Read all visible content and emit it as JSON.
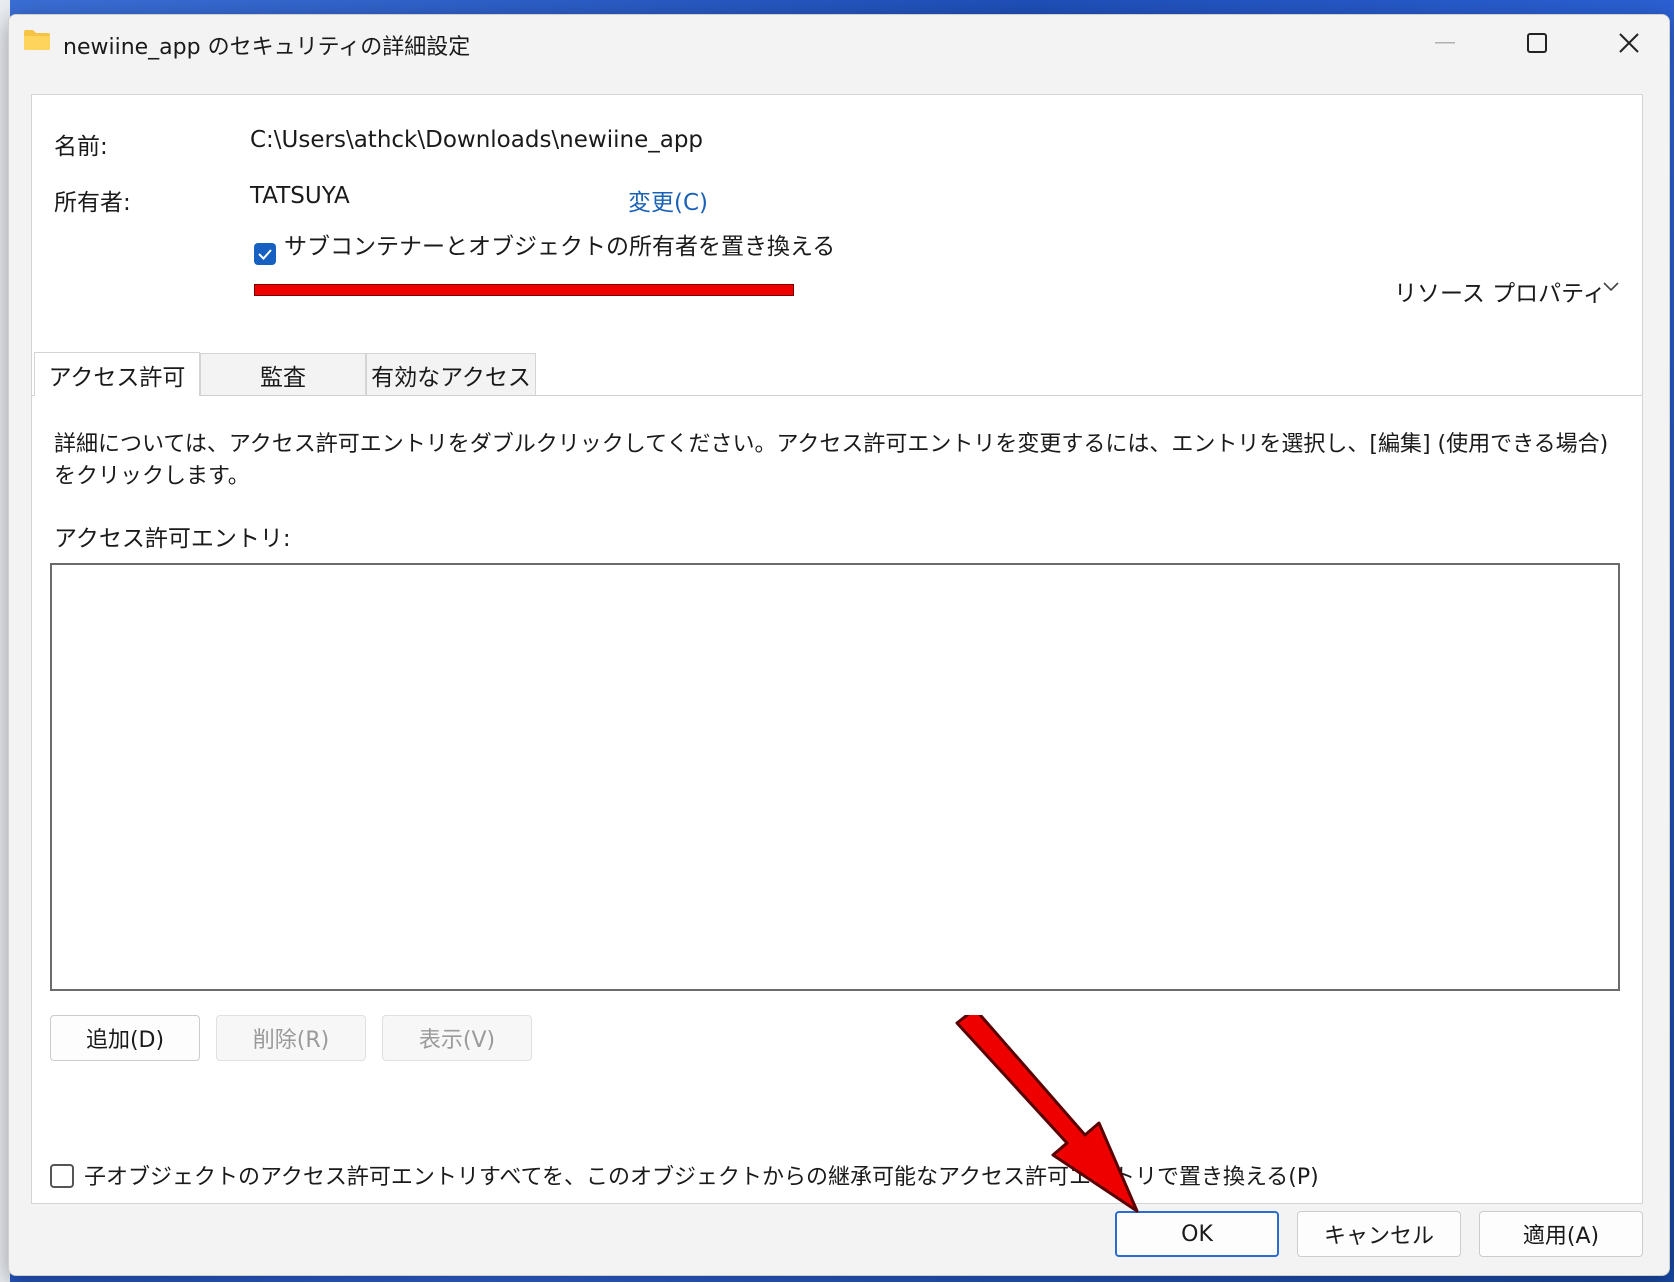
{
  "window": {
    "title": "newiine_app のセキュリティの詳細設定"
  },
  "info": {
    "name_label": "名前:",
    "name_value": "C:\\Users\\athck\\Downloads\\newiine_app",
    "owner_label": "所有者:",
    "owner_value": "TATSUYA",
    "change_link": "変更(C)",
    "replace_owner_checkbox": {
      "label": "サブコンテナーとオブジェクトの所有者を置き換える",
      "checked": true
    },
    "resource_properties": "リソース プロパティ"
  },
  "tabs": [
    {
      "label": "アクセス許可",
      "active": true
    },
    {
      "label": "監査",
      "active": false
    },
    {
      "label": "有効なアクセス",
      "active": false
    }
  ],
  "permissions": {
    "description": "詳細については、アクセス許可エントリをダブルクリックしてください。アクセス許可エントリを変更するには、エントリを選択し、[編集] (使用できる場合) をクリックします。",
    "entries_label": "アクセス許可エントリ:",
    "add_button": "追加(D)",
    "remove_button": "削除(R)",
    "view_button": "表示(V)",
    "replace_child_checkbox": {
      "label": "子オブジェクトのアクセス許可エントリすべてを、このオブジェクトからの継承可能なアクセス許可エントリで置き換える(P)",
      "checked": false
    }
  },
  "footer": {
    "ok_button": "OK",
    "cancel_button": "キャンセル",
    "apply_button": "適用(A)"
  },
  "colors": {
    "accent": "#1560c0",
    "link": "#1a62b5",
    "annotation_red": "#ee0000"
  }
}
